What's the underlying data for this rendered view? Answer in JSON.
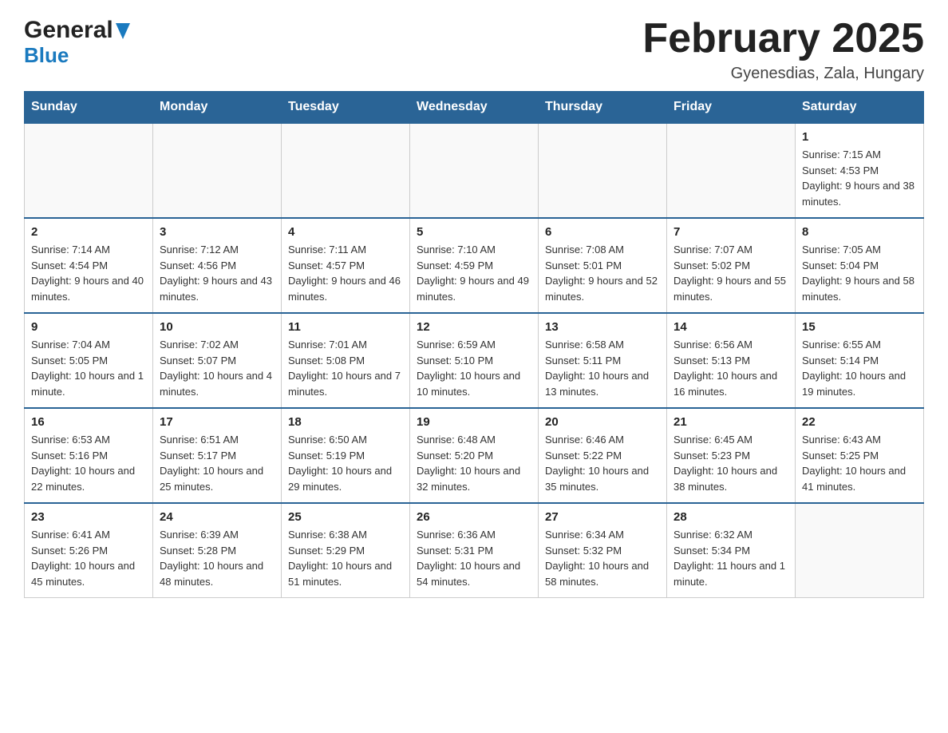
{
  "header": {
    "logo_general": "General",
    "logo_blue": "Blue",
    "title": "February 2025",
    "subtitle": "Gyenesdias, Zala, Hungary"
  },
  "weekdays": [
    "Sunday",
    "Monday",
    "Tuesday",
    "Wednesday",
    "Thursday",
    "Friday",
    "Saturday"
  ],
  "weeks": [
    [
      {
        "day": "",
        "info": ""
      },
      {
        "day": "",
        "info": ""
      },
      {
        "day": "",
        "info": ""
      },
      {
        "day": "",
        "info": ""
      },
      {
        "day": "",
        "info": ""
      },
      {
        "day": "",
        "info": ""
      },
      {
        "day": "1",
        "info": "Sunrise: 7:15 AM\nSunset: 4:53 PM\nDaylight: 9 hours and 38 minutes."
      }
    ],
    [
      {
        "day": "2",
        "info": "Sunrise: 7:14 AM\nSunset: 4:54 PM\nDaylight: 9 hours and 40 minutes."
      },
      {
        "day": "3",
        "info": "Sunrise: 7:12 AM\nSunset: 4:56 PM\nDaylight: 9 hours and 43 minutes."
      },
      {
        "day": "4",
        "info": "Sunrise: 7:11 AM\nSunset: 4:57 PM\nDaylight: 9 hours and 46 minutes."
      },
      {
        "day": "5",
        "info": "Sunrise: 7:10 AM\nSunset: 4:59 PM\nDaylight: 9 hours and 49 minutes."
      },
      {
        "day": "6",
        "info": "Sunrise: 7:08 AM\nSunset: 5:01 PM\nDaylight: 9 hours and 52 minutes."
      },
      {
        "day": "7",
        "info": "Sunrise: 7:07 AM\nSunset: 5:02 PM\nDaylight: 9 hours and 55 minutes."
      },
      {
        "day": "8",
        "info": "Sunrise: 7:05 AM\nSunset: 5:04 PM\nDaylight: 9 hours and 58 minutes."
      }
    ],
    [
      {
        "day": "9",
        "info": "Sunrise: 7:04 AM\nSunset: 5:05 PM\nDaylight: 10 hours and 1 minute."
      },
      {
        "day": "10",
        "info": "Sunrise: 7:02 AM\nSunset: 5:07 PM\nDaylight: 10 hours and 4 minutes."
      },
      {
        "day": "11",
        "info": "Sunrise: 7:01 AM\nSunset: 5:08 PM\nDaylight: 10 hours and 7 minutes."
      },
      {
        "day": "12",
        "info": "Sunrise: 6:59 AM\nSunset: 5:10 PM\nDaylight: 10 hours and 10 minutes."
      },
      {
        "day": "13",
        "info": "Sunrise: 6:58 AM\nSunset: 5:11 PM\nDaylight: 10 hours and 13 minutes."
      },
      {
        "day": "14",
        "info": "Sunrise: 6:56 AM\nSunset: 5:13 PM\nDaylight: 10 hours and 16 minutes."
      },
      {
        "day": "15",
        "info": "Sunrise: 6:55 AM\nSunset: 5:14 PM\nDaylight: 10 hours and 19 minutes."
      }
    ],
    [
      {
        "day": "16",
        "info": "Sunrise: 6:53 AM\nSunset: 5:16 PM\nDaylight: 10 hours and 22 minutes."
      },
      {
        "day": "17",
        "info": "Sunrise: 6:51 AM\nSunset: 5:17 PM\nDaylight: 10 hours and 25 minutes."
      },
      {
        "day": "18",
        "info": "Sunrise: 6:50 AM\nSunset: 5:19 PM\nDaylight: 10 hours and 29 minutes."
      },
      {
        "day": "19",
        "info": "Sunrise: 6:48 AM\nSunset: 5:20 PM\nDaylight: 10 hours and 32 minutes."
      },
      {
        "day": "20",
        "info": "Sunrise: 6:46 AM\nSunset: 5:22 PM\nDaylight: 10 hours and 35 minutes."
      },
      {
        "day": "21",
        "info": "Sunrise: 6:45 AM\nSunset: 5:23 PM\nDaylight: 10 hours and 38 minutes."
      },
      {
        "day": "22",
        "info": "Sunrise: 6:43 AM\nSunset: 5:25 PM\nDaylight: 10 hours and 41 minutes."
      }
    ],
    [
      {
        "day": "23",
        "info": "Sunrise: 6:41 AM\nSunset: 5:26 PM\nDaylight: 10 hours and 45 minutes."
      },
      {
        "day": "24",
        "info": "Sunrise: 6:39 AM\nSunset: 5:28 PM\nDaylight: 10 hours and 48 minutes."
      },
      {
        "day": "25",
        "info": "Sunrise: 6:38 AM\nSunset: 5:29 PM\nDaylight: 10 hours and 51 minutes."
      },
      {
        "day": "26",
        "info": "Sunrise: 6:36 AM\nSunset: 5:31 PM\nDaylight: 10 hours and 54 minutes."
      },
      {
        "day": "27",
        "info": "Sunrise: 6:34 AM\nSunset: 5:32 PM\nDaylight: 10 hours and 58 minutes."
      },
      {
        "day": "28",
        "info": "Sunrise: 6:32 AM\nSunset: 5:34 PM\nDaylight: 11 hours and 1 minute."
      },
      {
        "day": "",
        "info": ""
      }
    ]
  ]
}
